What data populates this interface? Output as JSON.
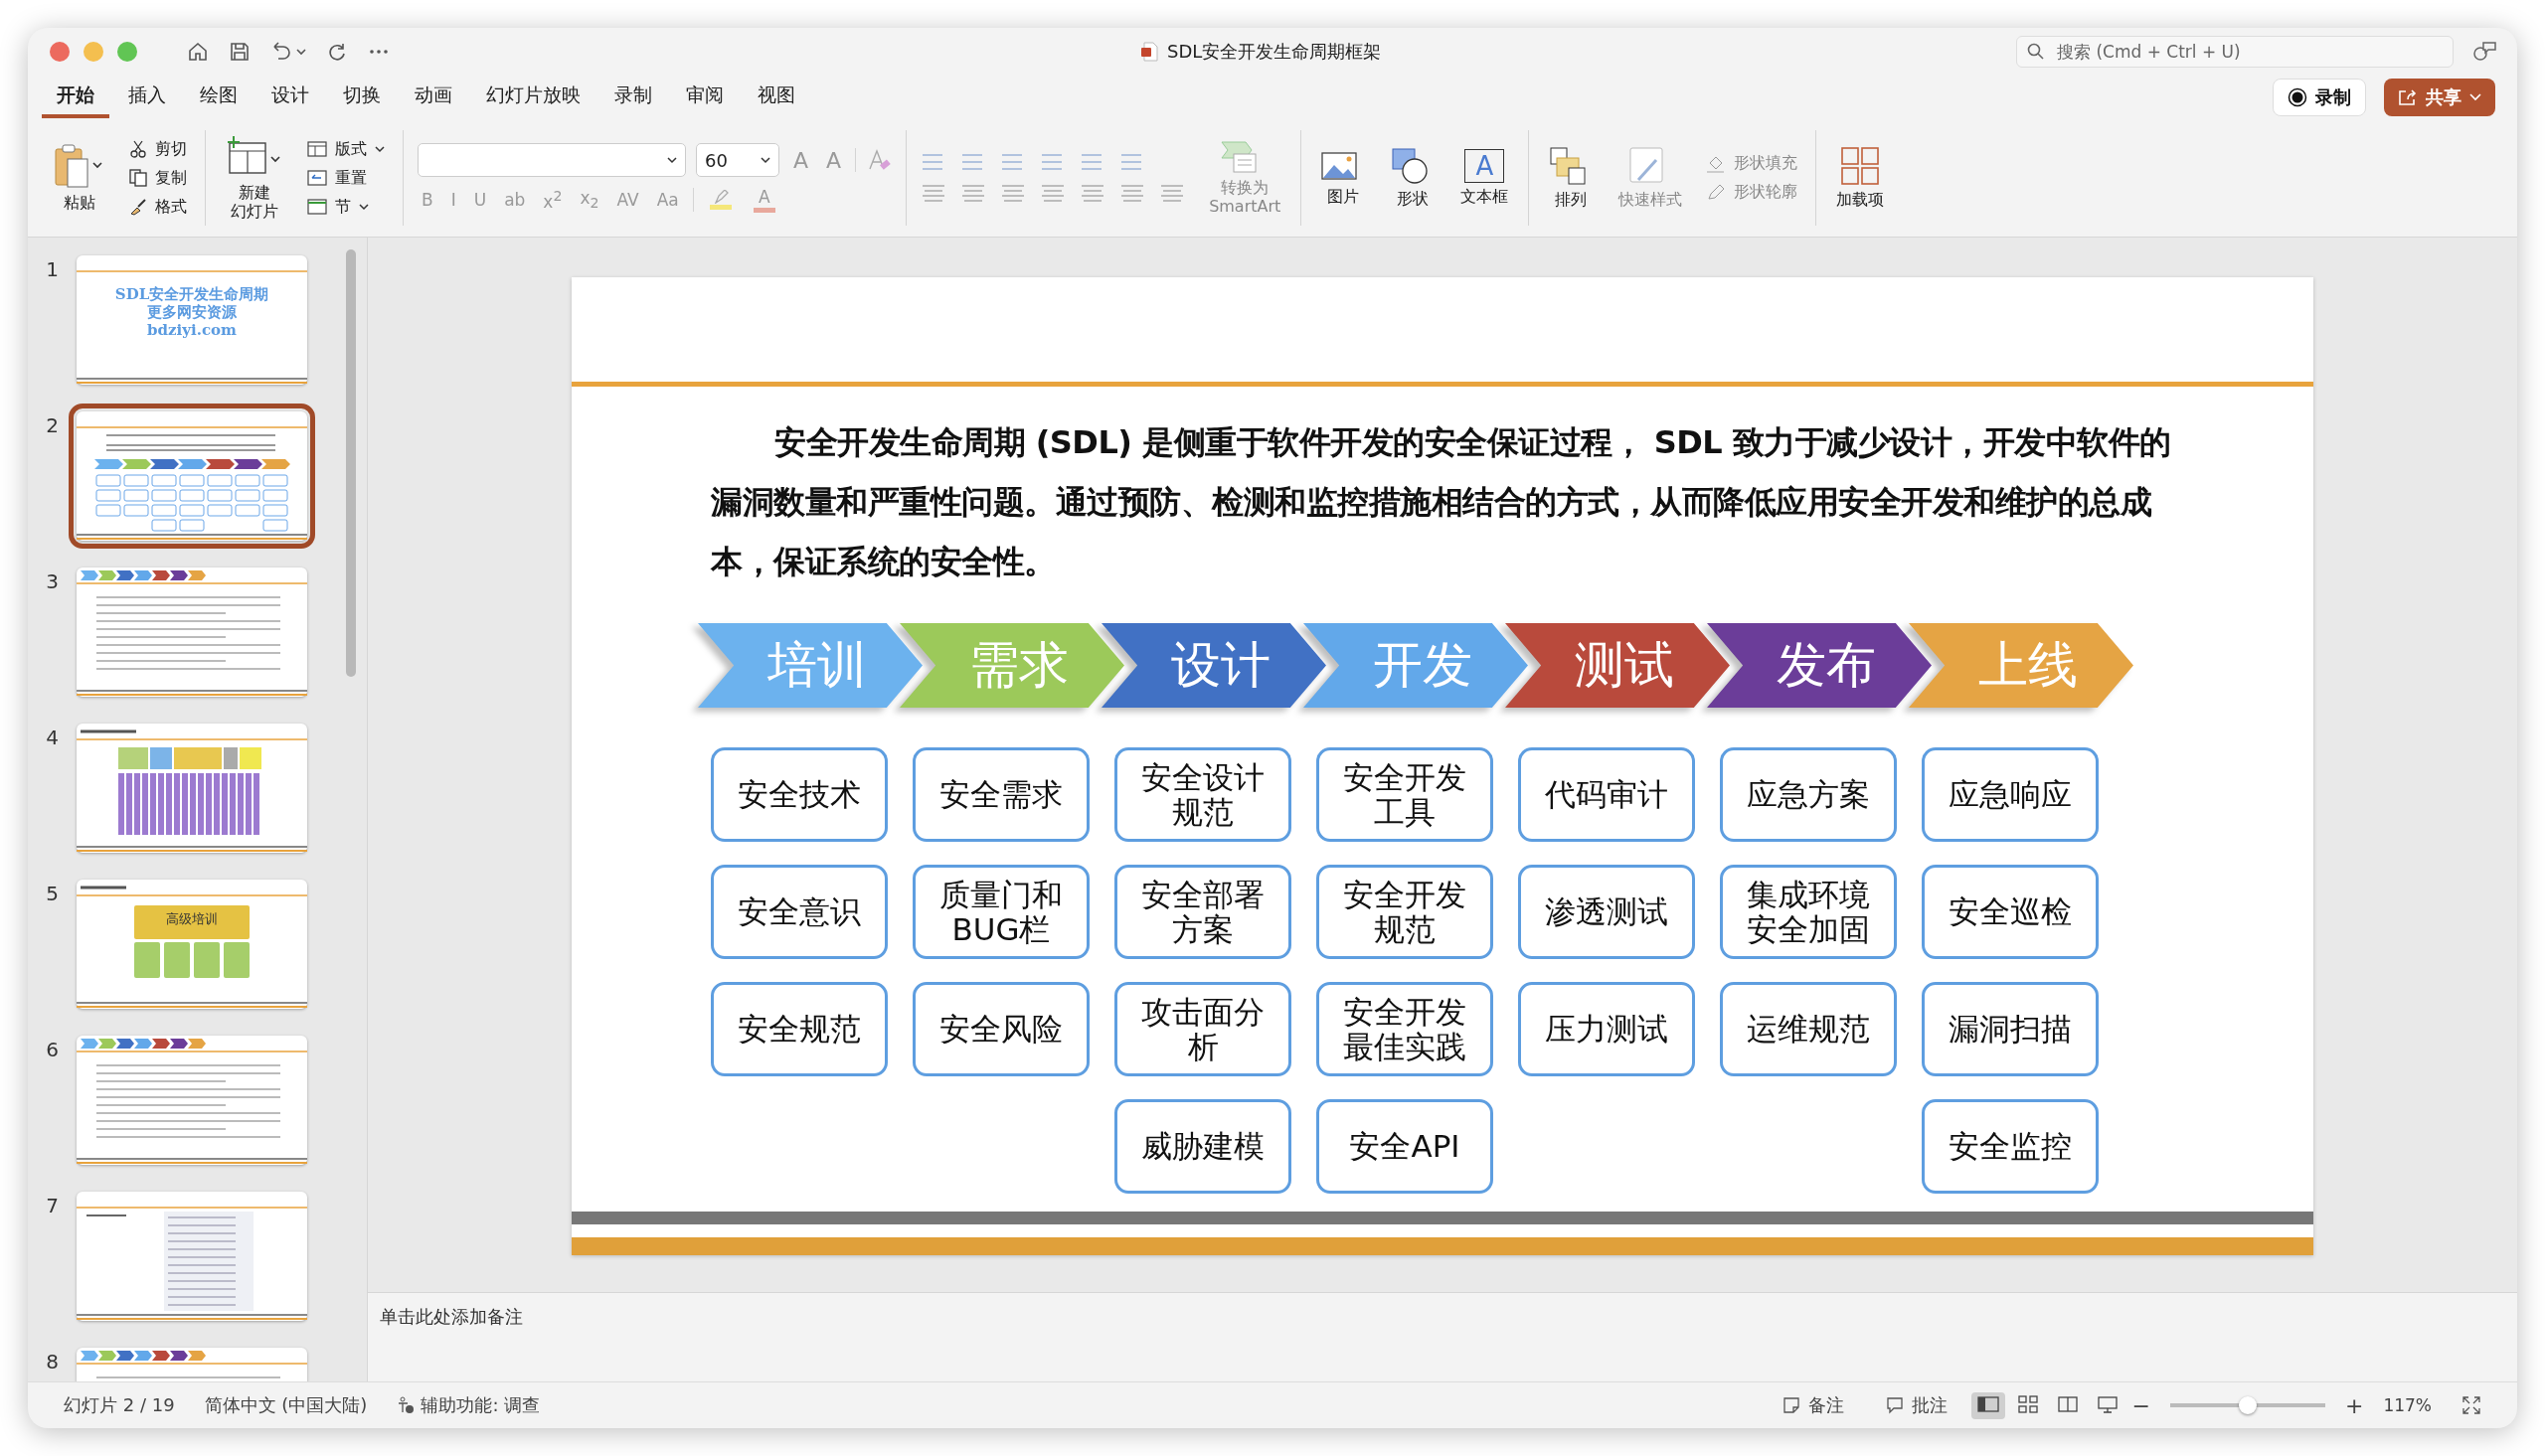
{
  "window": {
    "title": "SDL安全开发生命周期框架"
  },
  "search": {
    "placeholder": "搜索 (Cmd + Ctrl + U)"
  },
  "tabs": [
    {
      "label": "开始",
      "selected": true
    },
    {
      "label": "插入",
      "selected": false
    },
    {
      "label": "绘图",
      "selected": false
    },
    {
      "label": "设计",
      "selected": false
    },
    {
      "label": "切换",
      "selected": false
    },
    {
      "label": "动画",
      "selected": false
    },
    {
      "label": "幻灯片放映",
      "selected": false
    },
    {
      "label": "录制",
      "selected": false
    },
    {
      "label": "审阅",
      "selected": false
    },
    {
      "label": "视图",
      "selected": false
    }
  ],
  "record_button": "录制",
  "share_button": "共享",
  "ribbon": {
    "paste": "粘贴",
    "clipboard_items": [
      {
        "kind": "cut",
        "label": "剪切"
      },
      {
        "kind": "copy",
        "label": "复制"
      },
      {
        "kind": "format",
        "label": "格式"
      }
    ],
    "new_slide": [
      "新建",
      "幻灯片"
    ],
    "slide_items": [
      {
        "kind": "layout",
        "label": "版式"
      },
      {
        "kind": "reset",
        "label": "重置"
      },
      {
        "kind": "section",
        "label": "节"
      }
    ],
    "font_size": "60",
    "grow_buttons": [
      "A",
      "A"
    ],
    "format_buttons": [
      "B",
      "I",
      "U",
      "ab",
      "x$^{2}$",
      "x$_{2}$",
      "AV",
      "Aa"
    ],
    "color_buttons": [
      {
        "kind": "highlight",
        "color": "#f5e77a"
      },
      {
        "kind": "font",
        "color": "#e8a89c",
        "label": "A"
      }
    ],
    "smartart": [
      "转换为",
      "SmartArt"
    ],
    "insert_items": [
      {
        "kind": "picture",
        "label": "图片"
      },
      {
        "kind": "shape",
        "label": "形状"
      },
      {
        "kind": "textbox",
        "label": "文本框",
        "glyph": "A"
      }
    ],
    "arrange": "排列",
    "quick_styles": "快速样式",
    "shape_fill": "形状填充",
    "shape_outline": "形状轮廓",
    "addins": "加载项"
  },
  "thumbnails": [
    {
      "number": "1",
      "kind": "title",
      "selected": false,
      "lines": [
        "SDL安全开发生命周期",
        "更多网安资源",
        "bdziyi.com"
      ]
    },
    {
      "number": "2",
      "kind": "diagram",
      "selected": true
    },
    {
      "number": "3",
      "kind": "text",
      "selected": false
    },
    {
      "number": "4",
      "kind": "blocks",
      "selected": false
    },
    {
      "number": "5",
      "kind": "training",
      "selected": false,
      "lines": [
        "高级培训"
      ]
    },
    {
      "number": "6",
      "kind": "text",
      "selected": false
    },
    {
      "number": "7",
      "kind": "table",
      "selected": false
    },
    {
      "number": "8",
      "kind": "text",
      "selected": false
    }
  ],
  "slide": {
    "paragraph": "安全开发生命周期 (SDL) 是侧重于软件开发的安全保证过程， SDL 致力于减少设计，开发中软件的漏洞数量和严重性问题。通过预防、检测和监控措施相结合的方式，从而降低应用安全开发和维护的总成本，保证系统的安全性。",
    "phases": [
      {
        "label": "培训",
        "color": "#6cb2ee",
        "items": [
          "安全技术",
          "安全意识",
          "安全规范"
        ]
      },
      {
        "label": "需求",
        "color": "#9cc95a",
        "items": [
          "安全需求",
          "质量门和BUG栏",
          "安全风险"
        ]
      },
      {
        "label": "设计",
        "color": "#4171c4",
        "items": [
          "安全设计规范",
          "安全部署方案",
          "攻击面分析",
          "威胁建模"
        ]
      },
      {
        "label": "开发",
        "color": "#62a8ea",
        "items": [
          "安全开发工具",
          "安全开发规范",
          "安全开发最佳实践",
          "安全API"
        ]
      },
      {
        "label": "测试",
        "color": "#b94a3c",
        "items": [
          "代码审计",
          "渗透测试",
          "压力测试"
        ]
      },
      {
        "label": "发布",
        "color": "#6b3d99",
        "items": [
          "应急方案",
          "集成环境安全加固",
          "运维规范"
        ]
      },
      {
        "label": "上线",
        "color": "#e5a444",
        "items": [
          "应急响应",
          "安全巡检",
          "漏洞扫描",
          "安全监控"
        ]
      }
    ]
  },
  "notes": {
    "placeholder": "单击此处添加备注"
  },
  "status_bar": {
    "slide_count": "幻灯片 2 / 19",
    "language": "简体中文 (中国大陆)",
    "accessibility": "辅助功能: 调查",
    "notes": "备注",
    "comments": "批注",
    "views": [
      {
        "kind": "normal",
        "selected": true
      },
      {
        "kind": "sorter",
        "selected": false
      },
      {
        "kind": "reading",
        "selected": false
      },
      {
        "kind": "show",
        "selected": false
      }
    ],
    "zoom_out": "−",
    "zoom_in": "+",
    "zoom": {
      "level": 0.5
    },
    "zoom_value": "117%"
  }
}
